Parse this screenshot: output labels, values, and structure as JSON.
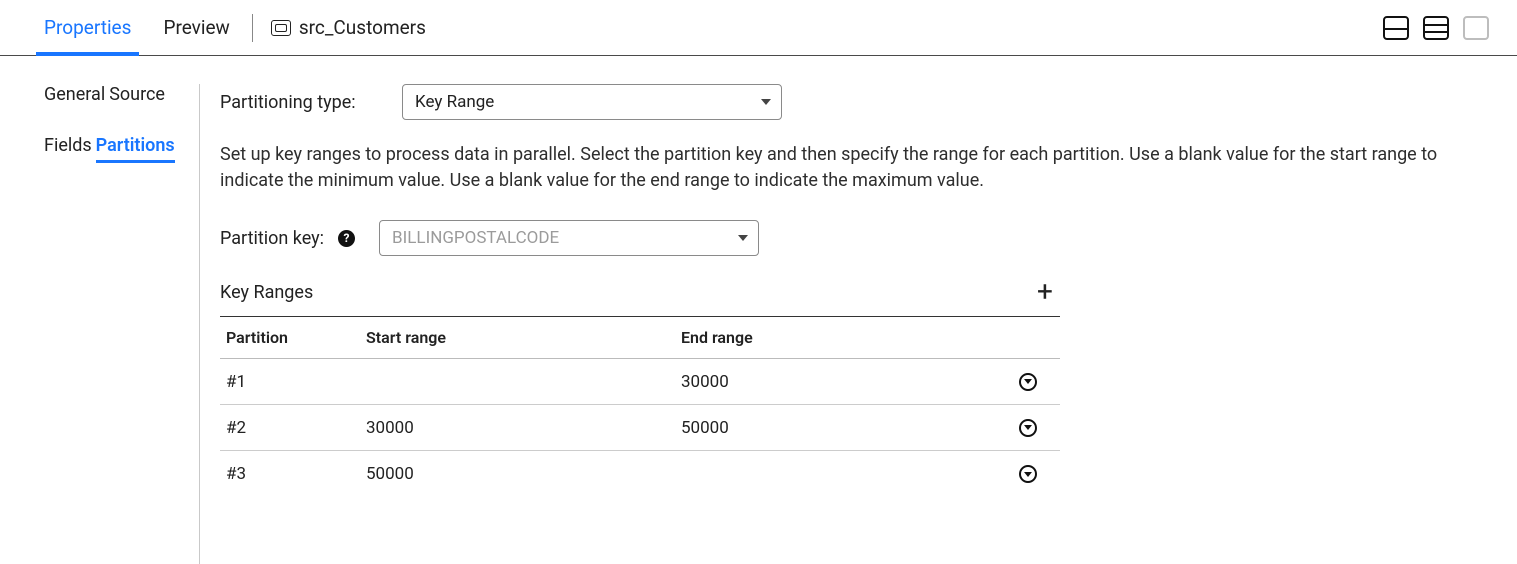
{
  "header": {
    "tabs": [
      "Properties",
      "Preview"
    ],
    "activeTab": 0,
    "sourceName": "src_Customers"
  },
  "sidebar": {
    "items": [
      "General",
      "Source",
      "Fields",
      "Partitions"
    ],
    "activeIndex": 3
  },
  "partitioning": {
    "typeLabel": "Partitioning type:",
    "typeValue": "Key Range",
    "description": "Set up key ranges to process data in parallel. Select the partition key and then specify the range for each partition. Use a blank value for the start range to indicate the minimum value. Use a blank value for the end range to indicate the maximum value.",
    "keyLabel": "Partition key:",
    "keyValue": "BILLINGPOSTALCODE"
  },
  "keyRanges": {
    "title": "Key Ranges",
    "columns": [
      "Partition",
      "Start range",
      "End range"
    ],
    "rows": [
      {
        "partition": "#1",
        "start": "",
        "end": "30000"
      },
      {
        "partition": "#2",
        "start": "30000",
        "end": "50000"
      },
      {
        "partition": "#3",
        "start": "50000",
        "end": ""
      }
    ]
  }
}
